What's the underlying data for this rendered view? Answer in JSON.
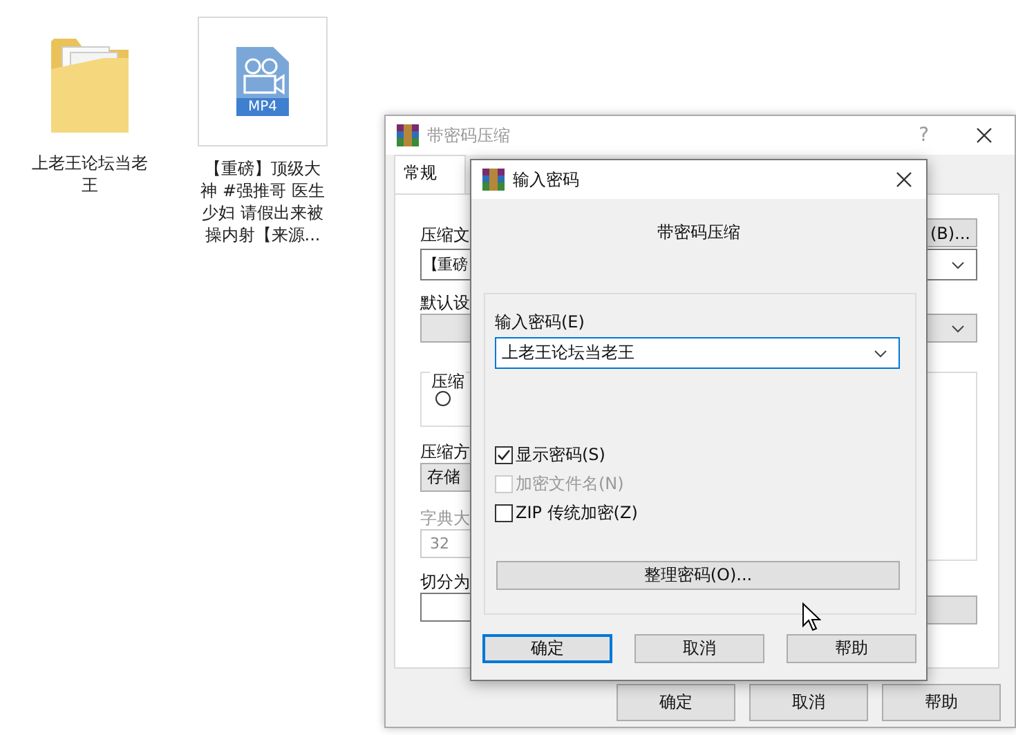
{
  "desktop": {
    "icons": [
      {
        "kind": "folder",
        "label": "上老王论坛当老王",
        "selected": false
      },
      {
        "kind": "video",
        "badge": "MP4",
        "label": "【重磅】顶级大神 #强推哥 医生少妇 请假出来被操内射【来源...",
        "selected": true
      }
    ]
  },
  "back_window": {
    "title": "带密码压缩",
    "active": false,
    "help_button": "?",
    "tabs": [
      {
        "label": "常规",
        "selected": true
      }
    ],
    "archive_label": "压缩文",
    "browse_button": "(B)...",
    "archive_value": "【重磅",
    "profile_label": "默认设",
    "format_group_label": "压缩",
    "format_radio": {
      "checked": false
    },
    "method_label": "压缩方",
    "method_value": "存储",
    "dictionary": {
      "label": "字典大",
      "value": "32",
      "disabled": true
    },
    "split_label": "切分为",
    "buttons": [
      {
        "label": "确定"
      },
      {
        "label": "取消"
      },
      {
        "label": "帮助"
      }
    ]
  },
  "dialog": {
    "title": "输入密码",
    "heading": "带密码压缩",
    "password": {
      "label": "输入密码(E)",
      "value": "上老王论坛当老王"
    },
    "options": [
      {
        "label": "显示密码(S)",
        "checked": true,
        "disabled": false
      },
      {
        "label": "加密文件名(N)",
        "checked": false,
        "disabled": true
      },
      {
        "label": "ZIP 传统加密(Z)",
        "checked": false,
        "disabled": false
      }
    ],
    "organize_button": "整理密码(O)...",
    "buttons": [
      {
        "label": "确定",
        "default": true
      },
      {
        "label": "取消",
        "default": false
      },
      {
        "label": "帮助",
        "default": false
      }
    ]
  }
}
